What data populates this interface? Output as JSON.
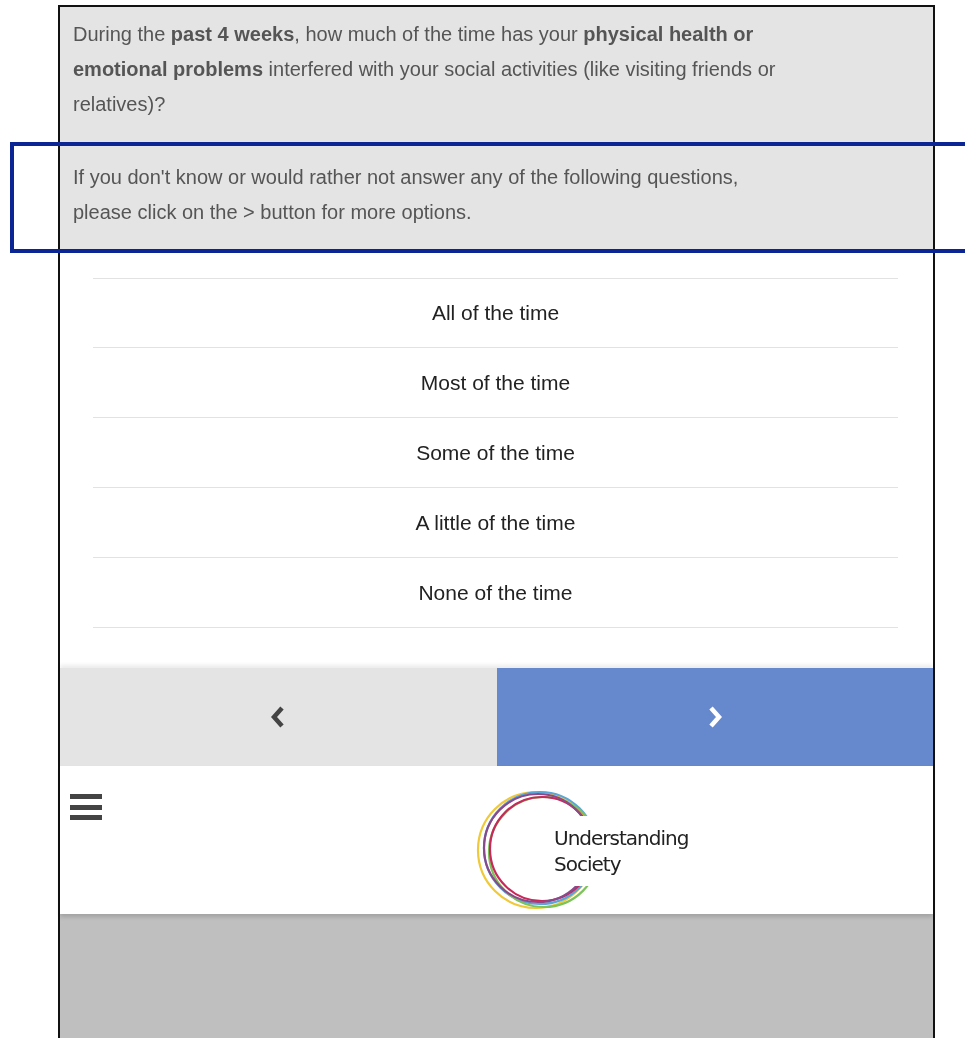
{
  "question": {
    "text": "During the **past 4 weeks**, how much of the time has your **physical health or emotional problems** interfered with your social activities (like visiting friends or relatives)?"
  },
  "instruction": {
    "text": "If you don't know or would rather not answer any of the following questions, please click on the > button for more options.",
    "highlighted": true
  },
  "options": [
    {
      "label": "All of the time",
      "selected": false
    },
    {
      "label": "Most of the time",
      "selected": false
    },
    {
      "label": "Some of the time",
      "selected": false
    },
    {
      "label": "A little of the time",
      "selected": false
    },
    {
      "label": "None of the time",
      "selected": false
    }
  ],
  "logo": {
    "lines": [
      "Understanding",
      "Society"
    ]
  }
}
